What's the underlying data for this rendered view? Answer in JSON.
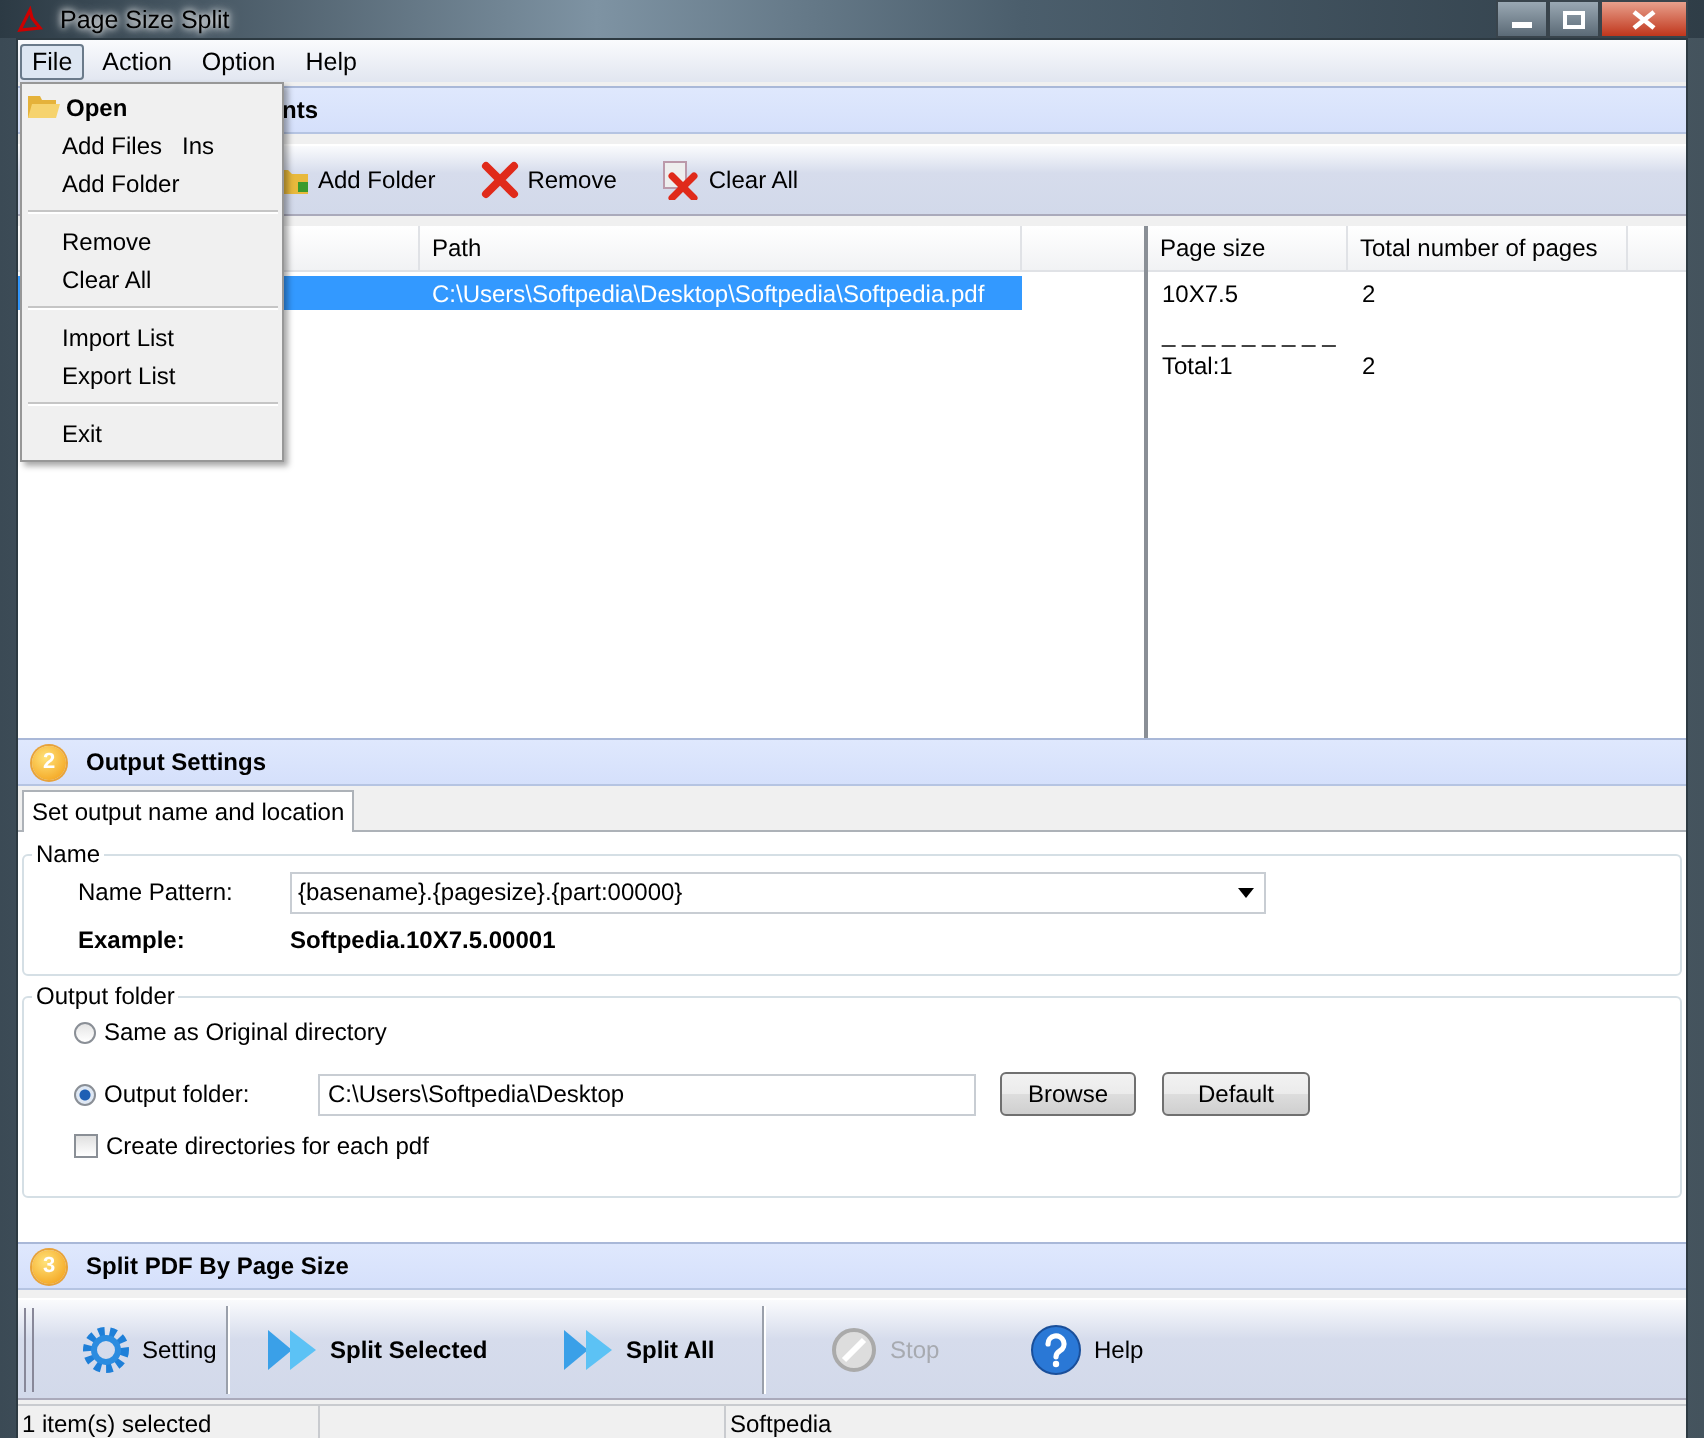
{
  "window": {
    "title": "Page Size Split"
  },
  "menu_bar": [
    {
      "label": "File",
      "selected": true
    },
    {
      "label": "Action",
      "selected": false
    },
    {
      "label": "Option",
      "selected": false
    },
    {
      "label": "Help",
      "selected": false
    }
  ],
  "file_menu": [
    {
      "kind": "default",
      "label": "Open"
    },
    {
      "kind": "item",
      "label": "Add Files",
      "shortcut": "Ins"
    },
    {
      "kind": "item",
      "label": "Add Folder"
    },
    {
      "kind": "separator"
    },
    {
      "kind": "item",
      "label": "Remove"
    },
    {
      "kind": "item",
      "label": "Clear All"
    },
    {
      "kind": "separator"
    },
    {
      "kind": "item",
      "label": "Import List"
    },
    {
      "kind": "item",
      "label": "Export List"
    },
    {
      "kind": "separator"
    },
    {
      "kind": "item",
      "label": "Exit"
    }
  ],
  "section_1": {
    "title": "nts"
  },
  "toolbar": [
    {
      "kind": "folder",
      "label": "Add Folder"
    },
    {
      "kind": "remove",
      "label": "Remove"
    },
    {
      "kind": "clear",
      "label": "Clear All"
    }
  ],
  "file_list": {
    "columns": [
      "Path"
    ],
    "rows": [
      {
        "path": "C:\\Users\\Softpedia\\Desktop\\Softpedia\\Softpedia.pdf",
        "selected": true
      }
    ]
  },
  "summary": {
    "columns": [
      "Page size",
      "Total number of pages"
    ],
    "rows": [
      {
        "kind": "row",
        "size": "10X7.5",
        "pages": "2"
      },
      {
        "kind": "rule",
        "size": "_ _ _ _ _ _ _ _ _"
      },
      {
        "kind": "row",
        "size": "Total:1",
        "pages": "2"
      }
    ]
  },
  "section_2": {
    "step": "2",
    "title": "Output Settings"
  },
  "output": {
    "tab": "Set output name and location",
    "name_legend": "Name",
    "pattern_label": "Name Pattern:",
    "pattern": "{basename}.{pagesize}.{part:00000}",
    "example_label": "Example:",
    "example": "Softpedia.10X7.5.00001",
    "folder_legend": "Output folder",
    "radios": [
      {
        "label": "Same as Original directory",
        "selected": false
      },
      {
        "label": "Output folder:",
        "selected": true
      }
    ],
    "folder": "C:\\Users\\Softpedia\\Desktop",
    "browse": "Browse",
    "default": "Default",
    "checkbox": {
      "label": "Create directories for each pdf",
      "checked": false
    }
  },
  "section_3": {
    "step": "3",
    "title": "Split PDF By Page Size"
  },
  "actions": [
    {
      "kind": "gear",
      "label": "Setting",
      "bold": false,
      "disabled": false
    },
    {
      "kind": "play",
      "label": "Split Selected",
      "bold": true,
      "disabled": false
    },
    {
      "kind": "play",
      "label": "Split All",
      "bold": true,
      "disabled": false
    },
    {
      "kind": "stop",
      "label": "Stop",
      "bold": false,
      "disabled": true
    },
    {
      "kind": "help",
      "label": "Help",
      "bold": false,
      "disabled": false
    }
  ],
  "status_bar": [
    "1 item(s) selected",
    "Softpedia"
  ]
}
